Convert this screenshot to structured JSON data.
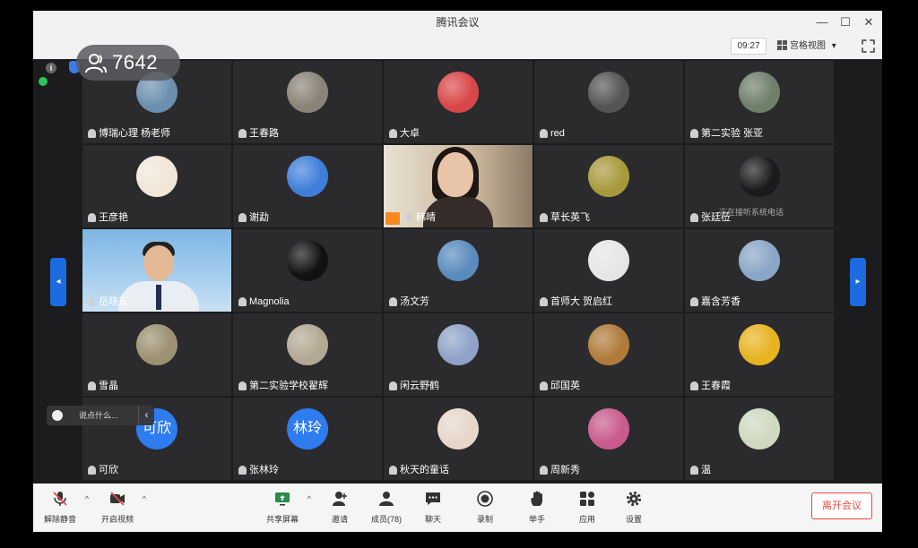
{
  "window": {
    "title": "腾讯会议",
    "minimize": "—",
    "maximize": "☐",
    "close": "✕"
  },
  "infobar": {
    "timer": "09:27",
    "view_label": "宫格视图",
    "view_caret": "▾"
  },
  "participants_count": "7642",
  "tiles": [
    {
      "name": "博瑞心理 杨老师",
      "type": "avatar",
      "color": "#6b8fae"
    },
    {
      "name": "王春路",
      "type": "avatar",
      "color": "#8a8478"
    },
    {
      "name": "大卓",
      "type": "avatar",
      "color": "#d94848"
    },
    {
      "name": "red",
      "type": "avatar",
      "color": "#555555"
    },
    {
      "name": "第二实验 张亚",
      "type": "avatar",
      "color": "#6f7f6a"
    },
    {
      "name": "王彦艳",
      "type": "avatar",
      "color": "#f1e7d8"
    },
    {
      "name": "谢勐",
      "type": "avatar",
      "color": "#3f7fd9"
    },
    {
      "name": "韩晴",
      "type": "video"
    },
    {
      "name": "草长英飞",
      "type": "avatar",
      "color": "#a89a3c"
    },
    {
      "name": "张廷莅",
      "type": "avatar",
      "color": "#1a1a1a"
    },
    {
      "name": "岳晓东",
      "type": "video2"
    },
    {
      "name": "Magnolia",
      "type": "avatar",
      "color": "#111111"
    },
    {
      "name": "汤文芳",
      "type": "avatar",
      "color": "#5a8bbd"
    },
    {
      "name": "首师大 贺启红",
      "type": "avatar",
      "color": "#e6e6e6"
    },
    {
      "name": "嘉含芳香",
      "type": "avatar",
      "color": "#8aa6c6"
    },
    {
      "name": "雪晶",
      "type": "avatar",
      "color": "#9c9170"
    },
    {
      "name": "第二实验学校翟辉",
      "type": "avatar",
      "color": "#b3a893"
    },
    {
      "name": "闲云野鹤",
      "type": "avatar",
      "color": "#8fa3c8"
    },
    {
      "name": "邱国英",
      "type": "avatar",
      "color": "#b07a3a"
    },
    {
      "name": "王春霞",
      "type": "avatar",
      "color": "#e8b320"
    },
    {
      "name": "可欣",
      "type": "text",
      "initials": "可欣"
    },
    {
      "name": "张林玲",
      "type": "text",
      "initials": "林玲"
    },
    {
      "name": "秋天的童话",
      "type": "avatar",
      "color": "#e7d7cb"
    },
    {
      "name": "周新秀",
      "type": "avatar",
      "color": "#c95b8e"
    },
    {
      "name": "温",
      "type": "avatar",
      "color": "#cfd9c0"
    }
  ],
  "callout_tip": "正在接听系统电话",
  "pager": {
    "prev": "◂",
    "next": "▸"
  },
  "chat": {
    "text": "说点什么...",
    "collapse": "‹"
  },
  "toolbar": {
    "mute": "解除静音",
    "video": "开启视频",
    "share": "共享屏幕",
    "invite": "邀请",
    "members": "成员(78)",
    "chat": "聊天",
    "record": "录制",
    "raise_hand": "举手",
    "apps": "应用",
    "settings": "设置",
    "leave": "离开会议",
    "caret": "^"
  },
  "colors": {
    "accent": "#1d6be0",
    "leave": "#e84a3f",
    "online": "#2cc55b",
    "host": "#f48a1f"
  }
}
